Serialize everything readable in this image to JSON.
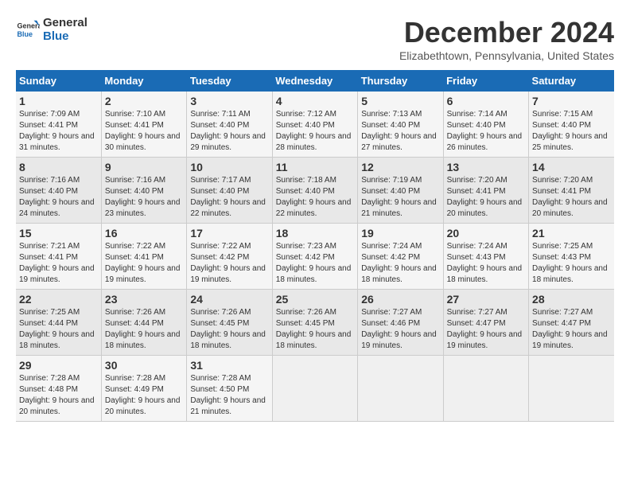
{
  "logo": {
    "line1": "General",
    "line2": "Blue"
  },
  "header": {
    "title": "December 2024",
    "location": "Elizabethtown, Pennsylvania, United States"
  },
  "days_of_week": [
    "Sunday",
    "Monday",
    "Tuesday",
    "Wednesday",
    "Thursday",
    "Friday",
    "Saturday"
  ],
  "weeks": [
    [
      {
        "day": "1",
        "sunrise": "7:09 AM",
        "sunset": "4:41 PM",
        "daylight": "9 hours and 31 minutes."
      },
      {
        "day": "2",
        "sunrise": "7:10 AM",
        "sunset": "4:41 PM",
        "daylight": "9 hours and 30 minutes."
      },
      {
        "day": "3",
        "sunrise": "7:11 AM",
        "sunset": "4:40 PM",
        "daylight": "9 hours and 29 minutes."
      },
      {
        "day": "4",
        "sunrise": "7:12 AM",
        "sunset": "4:40 PM",
        "daylight": "9 hours and 28 minutes."
      },
      {
        "day": "5",
        "sunrise": "7:13 AM",
        "sunset": "4:40 PM",
        "daylight": "9 hours and 27 minutes."
      },
      {
        "day": "6",
        "sunrise": "7:14 AM",
        "sunset": "4:40 PM",
        "daylight": "9 hours and 26 minutes."
      },
      {
        "day": "7",
        "sunrise": "7:15 AM",
        "sunset": "4:40 PM",
        "daylight": "9 hours and 25 minutes."
      }
    ],
    [
      {
        "day": "8",
        "sunrise": "7:16 AM",
        "sunset": "4:40 PM",
        "daylight": "9 hours and 24 minutes."
      },
      {
        "day": "9",
        "sunrise": "7:16 AM",
        "sunset": "4:40 PM",
        "daylight": "9 hours and 23 minutes."
      },
      {
        "day": "10",
        "sunrise": "7:17 AM",
        "sunset": "4:40 PM",
        "daylight": "9 hours and 22 minutes."
      },
      {
        "day": "11",
        "sunrise": "7:18 AM",
        "sunset": "4:40 PM",
        "daylight": "9 hours and 22 minutes."
      },
      {
        "day": "12",
        "sunrise": "7:19 AM",
        "sunset": "4:40 PM",
        "daylight": "9 hours and 21 minutes."
      },
      {
        "day": "13",
        "sunrise": "7:20 AM",
        "sunset": "4:41 PM",
        "daylight": "9 hours and 20 minutes."
      },
      {
        "day": "14",
        "sunrise": "7:20 AM",
        "sunset": "4:41 PM",
        "daylight": "9 hours and 20 minutes."
      }
    ],
    [
      {
        "day": "15",
        "sunrise": "7:21 AM",
        "sunset": "4:41 PM",
        "daylight": "9 hours and 19 minutes."
      },
      {
        "day": "16",
        "sunrise": "7:22 AM",
        "sunset": "4:41 PM",
        "daylight": "9 hours and 19 minutes."
      },
      {
        "day": "17",
        "sunrise": "7:22 AM",
        "sunset": "4:42 PM",
        "daylight": "9 hours and 19 minutes."
      },
      {
        "day": "18",
        "sunrise": "7:23 AM",
        "sunset": "4:42 PM",
        "daylight": "9 hours and 18 minutes."
      },
      {
        "day": "19",
        "sunrise": "7:24 AM",
        "sunset": "4:42 PM",
        "daylight": "9 hours and 18 minutes."
      },
      {
        "day": "20",
        "sunrise": "7:24 AM",
        "sunset": "4:43 PM",
        "daylight": "9 hours and 18 minutes."
      },
      {
        "day": "21",
        "sunrise": "7:25 AM",
        "sunset": "4:43 PM",
        "daylight": "9 hours and 18 minutes."
      }
    ],
    [
      {
        "day": "22",
        "sunrise": "7:25 AM",
        "sunset": "4:44 PM",
        "daylight": "9 hours and 18 minutes."
      },
      {
        "day": "23",
        "sunrise": "7:26 AM",
        "sunset": "4:44 PM",
        "daylight": "9 hours and 18 minutes."
      },
      {
        "day": "24",
        "sunrise": "7:26 AM",
        "sunset": "4:45 PM",
        "daylight": "9 hours and 18 minutes."
      },
      {
        "day": "25",
        "sunrise": "7:26 AM",
        "sunset": "4:45 PM",
        "daylight": "9 hours and 18 minutes."
      },
      {
        "day": "26",
        "sunrise": "7:27 AM",
        "sunset": "4:46 PM",
        "daylight": "9 hours and 19 minutes."
      },
      {
        "day": "27",
        "sunrise": "7:27 AM",
        "sunset": "4:47 PM",
        "daylight": "9 hours and 19 minutes."
      },
      {
        "day": "28",
        "sunrise": "7:27 AM",
        "sunset": "4:47 PM",
        "daylight": "9 hours and 19 minutes."
      }
    ],
    [
      {
        "day": "29",
        "sunrise": "7:28 AM",
        "sunset": "4:48 PM",
        "daylight": "9 hours and 20 minutes."
      },
      {
        "day": "30",
        "sunrise": "7:28 AM",
        "sunset": "4:49 PM",
        "daylight": "9 hours and 20 minutes."
      },
      {
        "day": "31",
        "sunrise": "7:28 AM",
        "sunset": "4:50 PM",
        "daylight": "9 hours and 21 minutes."
      },
      null,
      null,
      null,
      null
    ]
  ]
}
